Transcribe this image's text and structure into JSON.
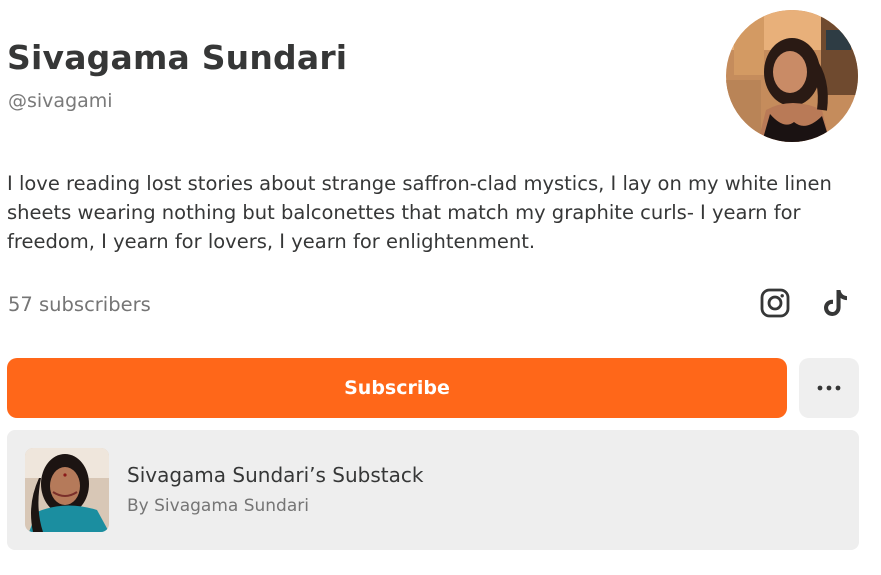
{
  "profile": {
    "name": "Sivagama Sundari",
    "handle": "@sivagami",
    "bio": "I love reading lost stories about strange saffron-clad mystics, I lay on my white linen sheets wearing nothing but balconettes that match my graphite curls- I yearn for freedom, I yearn for lovers, I yearn for enlightenment.",
    "subscribers": "57 subscribers"
  },
  "social": {
    "icons": [
      "instagram-icon",
      "tiktok-icon"
    ]
  },
  "actions": {
    "subscribe_label": "Subscribe",
    "more_icon": "more-horizontal-icon"
  },
  "publication": {
    "title": "Sivagama Sundari’s Substack",
    "author": "By Sivagama Sundari"
  },
  "colors": {
    "accent": "#ff6719",
    "text": "#363737",
    "muted": "#757575",
    "card_bg": "#eeeeee"
  }
}
